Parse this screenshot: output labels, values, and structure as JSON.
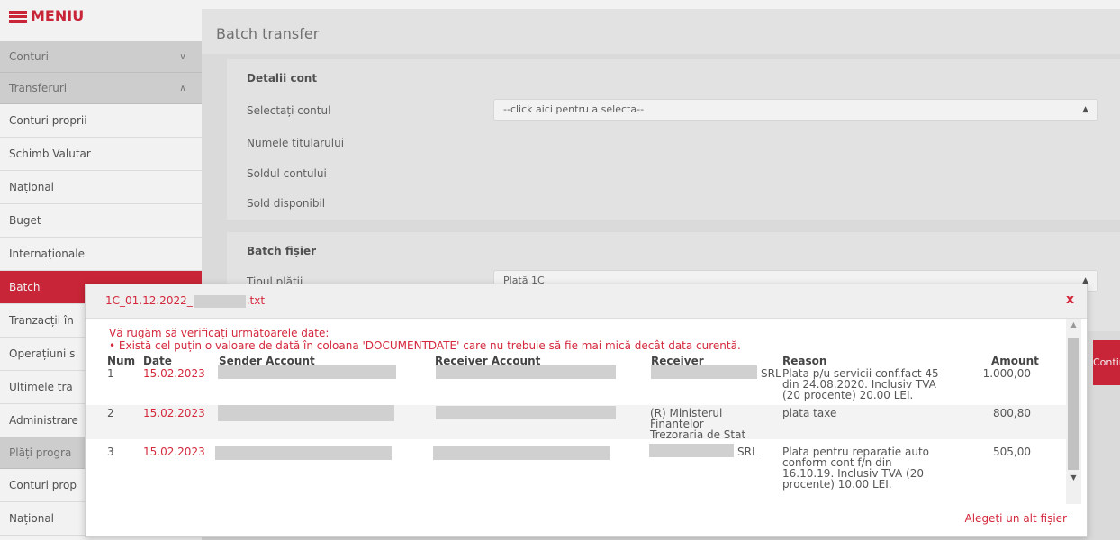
{
  "menu": {
    "title": "MENIU"
  },
  "sidebar": {
    "items": [
      {
        "label": "Conturi",
        "chevron": "chevron-down"
      },
      {
        "label": "Transferuri",
        "chevron": "chevron-up"
      },
      {
        "label": "Conturi proprii"
      },
      {
        "label": "Schimb Valutar"
      },
      {
        "label": "Național"
      },
      {
        "label": "Buget"
      },
      {
        "label": "Internaționale"
      },
      {
        "label": "Batch"
      },
      {
        "label": "Tranzacții în"
      },
      {
        "label": "Operațiuni s"
      },
      {
        "label": "Ultimele tra"
      },
      {
        "label": "Administrare"
      },
      {
        "label": "Plăți progra"
      },
      {
        "label": "Conturi prop"
      },
      {
        "label": "Național"
      }
    ]
  },
  "main": {
    "title": "Batch transfer",
    "account_details": {
      "title": "Detalii cont",
      "select_label": "Selectați contul",
      "select_value": "--click aici pentru a selecta--",
      "holder_label": "Numele titularului",
      "balance_label": "Soldul contului",
      "available_label": "Sold disponibil"
    },
    "batch_file": {
      "title": "Batch fișier",
      "payment_type_label": "Tipul plății",
      "payment_type_value": "Plată 1C"
    },
    "continue_label": "Continuă"
  },
  "modal": {
    "title_prefix": "1C_01.12.2022_",
    "title_suffix": ".txt",
    "close": "x",
    "message": "Vă rugăm să verificați următoarele date:",
    "error": "• Există cel puțin o valoare de dată în coloana 'DOCUMENTDATE' care nu trebuie să fie mai mică decât data curentă.",
    "columns": {
      "num": "Num",
      "date": "Date",
      "sender": "Sender Account",
      "receiver_account": "Receiver Account",
      "receiver": "Receiver",
      "reason": "Reason",
      "amount": "Amount"
    },
    "rows": [
      {
        "num": "1",
        "date": "15.02.2023",
        "receiver": "SRL",
        "reason": "Plata p/u servicii conf.fact 45 din 24.08.2020. Inclusiv TVA (20 procente) 20.00 LEI.",
        "amount": "1.000,00"
      },
      {
        "num": "2",
        "date": "15.02.2023",
        "receiver": "(R) Ministerul Finantelor Trezoraria de Stat",
        "reason": "plata taxe",
        "amount": "800,80"
      },
      {
        "num": "3",
        "date": "15.02.2023",
        "receiver": "SRL",
        "reason": "Plata pentru reparatie auto conform cont f/n din 16.10.19. Inclusiv TVA (20 procente) 10.00 LEI.",
        "amount": "505,00"
      }
    ],
    "alt_file_link": "Alegeți un alt fișier"
  },
  "colors": {
    "accent": "#d4283c",
    "panel": "#efefef",
    "background": "#e6e6e6"
  }
}
